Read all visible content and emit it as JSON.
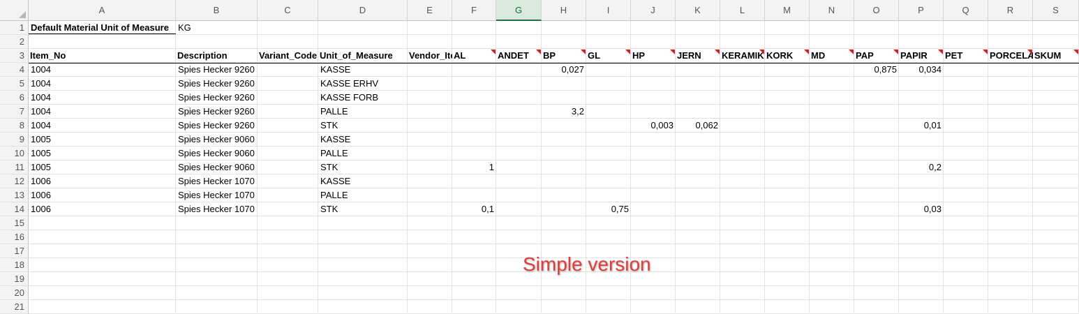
{
  "columns": [
    "A",
    "B",
    "C",
    "D",
    "E",
    "F",
    "G",
    "H",
    "I",
    "J",
    "K",
    "L",
    "M",
    "N",
    "O",
    "P",
    "Q",
    "R",
    "S"
  ],
  "selected_column": "G",
  "row_numbers": [
    "1",
    "2",
    "3",
    "4",
    "5",
    "6",
    "7",
    "8",
    "9",
    "10",
    "11",
    "12",
    "13",
    "14",
    "15",
    "16",
    "17",
    "18",
    "19",
    "20",
    "21"
  ],
  "meta": {
    "label": "Default Material Unit of Measure",
    "value": "KG"
  },
  "headers": [
    "Item_No",
    "Description",
    "Variant_Code",
    "Unit_of_Measure",
    "Vendor_Item_No",
    "AL",
    "ANDET",
    "BP",
    "GL",
    "HP",
    "JERN",
    "KERAMIK",
    "KORK",
    "MD",
    "PAP",
    "PAPIR",
    "PET",
    "PORCELÆN",
    "SKUM"
  ],
  "headers_with_comment": [
    "AL",
    "ANDET",
    "BP",
    "GL",
    "HP",
    "JERN",
    "KERAMIK",
    "KORK",
    "MD",
    "PAP",
    "PAPIR",
    "PET",
    "PORCELÆN",
    "SKUM"
  ],
  "rows": [
    {
      "item": "1004",
      "desc": "Spies Hecker 9260",
      "uom": "KASSE",
      "values": {
        "BP": "0,027",
        "PAP": "0,875",
        "PAPIR": "0,034"
      }
    },
    {
      "item": "1004",
      "desc": "Spies Hecker 9260",
      "uom": "KASSE ERHV",
      "values": {}
    },
    {
      "item": "1004",
      "desc": "Spies Hecker 9260",
      "uom": "KASSE FORB",
      "values": {}
    },
    {
      "item": "1004",
      "desc": "Spies Hecker 9260",
      "uom": "PALLE",
      "values": {
        "BP": "3,2"
      }
    },
    {
      "item": "1004",
      "desc": "Spies Hecker 9260",
      "uom": "STK",
      "values": {
        "HP": "0,003",
        "JERN": "0,062",
        "PAPIR": "0,01"
      }
    },
    {
      "item": "1005",
      "desc": "Spies Hecker 9060",
      "uom": "KASSE",
      "values": {}
    },
    {
      "item": "1005",
      "desc": "Spies Hecker 9060",
      "uom": "PALLE",
      "values": {}
    },
    {
      "item": "1005",
      "desc": "Spies Hecker 9060",
      "uom": "STK",
      "values": {
        "AL": "1",
        "PAPIR": "0,2"
      }
    },
    {
      "item": "1006",
      "desc": "Spies Hecker 1070",
      "uom": "KASSE",
      "values": {}
    },
    {
      "item": "1006",
      "desc": "Spies Hecker 1070",
      "uom": "PALLE",
      "values": {}
    },
    {
      "item": "1006",
      "desc": "Spies Hecker 1070",
      "uom": "STK",
      "values": {
        "AL": "0,1",
        "GL": "0,75",
        "PAPIR": "0,03"
      }
    }
  ],
  "overlay_text": "Simple version"
}
